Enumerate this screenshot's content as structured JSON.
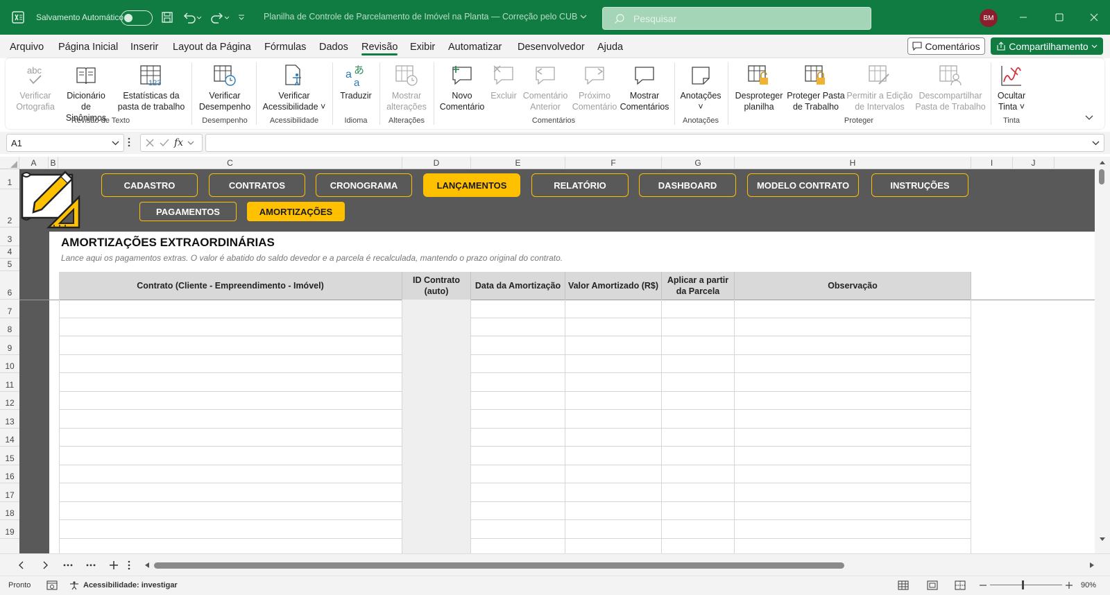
{
  "titlebar": {
    "autosave_label": "Salvamento Automático",
    "document_title": "Planilha de Controle de Parcelamento de Imóvel na Planta — Correção pelo CUB",
    "search_placeholder": "Pesquisar",
    "user_initials": "BM",
    "accent_color": "#107c41"
  },
  "menu": {
    "items": [
      "Arquivo",
      "Página Inicial",
      "Inserir",
      "Layout da Página",
      "Fórmulas",
      "Dados",
      "Revisão",
      "Exibir",
      "Automatizar",
      "Desenvolvedor",
      "Ajuda"
    ],
    "active": "Revisão",
    "comments_button": "Comentários",
    "share_button": "Compartilhamento"
  },
  "ribbon": {
    "buttons": {
      "spell": [
        "Verificar",
        "Ortografia"
      ],
      "thesaurus": [
        "Dicionário",
        "de Sinônimos"
      ],
      "stats": [
        "Estatísticas da",
        "pasta de trabalho"
      ],
      "perf": [
        "Verificar",
        "Desempenho"
      ],
      "access": [
        "Verificar",
        "Acessibilidade ˅"
      ],
      "translate": [
        "Traduzir",
        ""
      ],
      "changes": [
        "Mostrar",
        "alterações"
      ],
      "new_comment": [
        "Novo",
        "Comentário"
      ],
      "delete": [
        "Excluir",
        ""
      ],
      "prev": [
        "Comentário",
        "Anterior"
      ],
      "next": [
        "Próximo",
        "Comentário"
      ],
      "show": [
        "Mostrar",
        "Comentários"
      ],
      "notes": [
        "Anotações",
        "˅"
      ],
      "unprotect": [
        "Desproteger",
        "planilha"
      ],
      "protect_wb": [
        "Proteger Pasta",
        "de Trabalho"
      ],
      "allow": [
        "Permitir a Edição",
        "de Intervalos"
      ],
      "unshare": [
        "Descompartilhar",
        "Pasta de Trabalho"
      ],
      "ink": [
        "Ocultar",
        "Tinta ˅"
      ]
    },
    "groups": {
      "text_review": "Revisão de Texto",
      "performance": "Desempenho",
      "accessibility": "Acessibilidade",
      "language": "Idioma",
      "changes": "Alterações",
      "comments": "Comentários",
      "notes": "Anotações",
      "protect": "Proteger",
      "ink": "Tinta"
    }
  },
  "formula_bar": {
    "name_box": "A1",
    "fx": "fx",
    "formula": ""
  },
  "grid": {
    "columns": [
      "A",
      "B",
      "C",
      "D",
      "E",
      "F",
      "G",
      "H",
      "I",
      "J"
    ],
    "rows": [
      "1",
      "2",
      "3",
      "4",
      "5",
      "6",
      "7",
      "8",
      "9",
      "10",
      "11",
      "12",
      "13",
      "14",
      "15",
      "16",
      "17",
      "18",
      "19"
    ]
  },
  "sheet": {
    "nav_buttons": [
      "CADASTRO",
      "CONTRATOS",
      "CRONOGRAMA",
      "LANÇAMENTOS",
      "RELATÓRIO",
      "DASHBOARD",
      "MODELO CONTRATO",
      "INSTRUÇÕES"
    ],
    "nav_active": "LANÇAMENTOS",
    "sub_buttons": [
      "PAGAMENTOS",
      "AMORTIZAÇÕES"
    ],
    "sub_active": "AMORTIZAÇÕES",
    "title": "AMORTIZAÇÕES EXTRAORDINÁRIAS",
    "subtitle": "Lance aqui os pagamentos extras. O valor é abatido do saldo devedor e a parcela é recalculada, mantendo o prazo original do contrato.",
    "table_headers": [
      "Contrato (Cliente - Empreendimento - Imóvel)",
      "ID Contrato (auto)",
      "Data da Amortização",
      "Valor Amortizado (R$)",
      "Aplicar a partir da Parcela",
      "Observação"
    ],
    "highlight_color": "#ffc000",
    "band_color": "#595959"
  },
  "statusbar": {
    "ready": "Pronto",
    "accessibility": "Acessibilidade: investigar",
    "zoom": "90%"
  }
}
